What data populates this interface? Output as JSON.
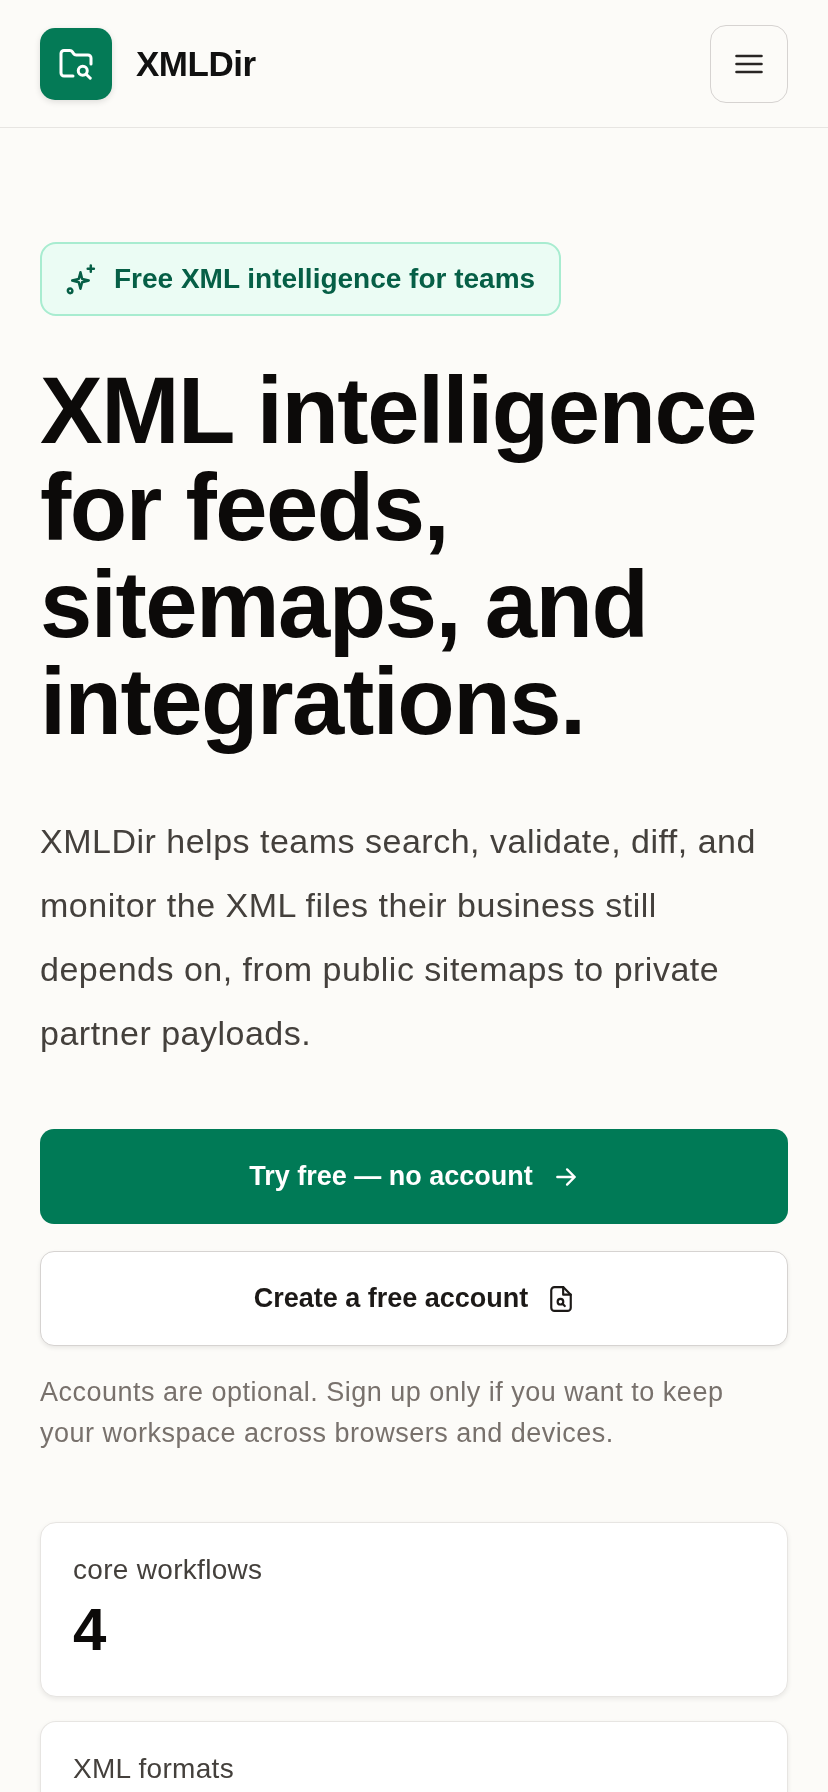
{
  "header": {
    "brand": "XMLDir"
  },
  "hero": {
    "badge": "Free XML intelligence for teams",
    "headline": "XML intelligence for feeds, sitemaps, and integrations.",
    "description": "XMLDir helps teams search, validate, diff, and monitor the XML files their business still depends on, from public sitemaps to private partner payloads."
  },
  "actions": [
    {
      "kind": "primary",
      "label": "Try free — no account"
    },
    {
      "kind": "secondary",
      "label": "Create a free account"
    }
  ],
  "note": "Accounts are optional. Sign up only if you want to keep your workspace across browsers and devices.",
  "stats": [
    {
      "label": "core workflows",
      "value": "4"
    },
    {
      "label": "XML formats"
    }
  ]
}
